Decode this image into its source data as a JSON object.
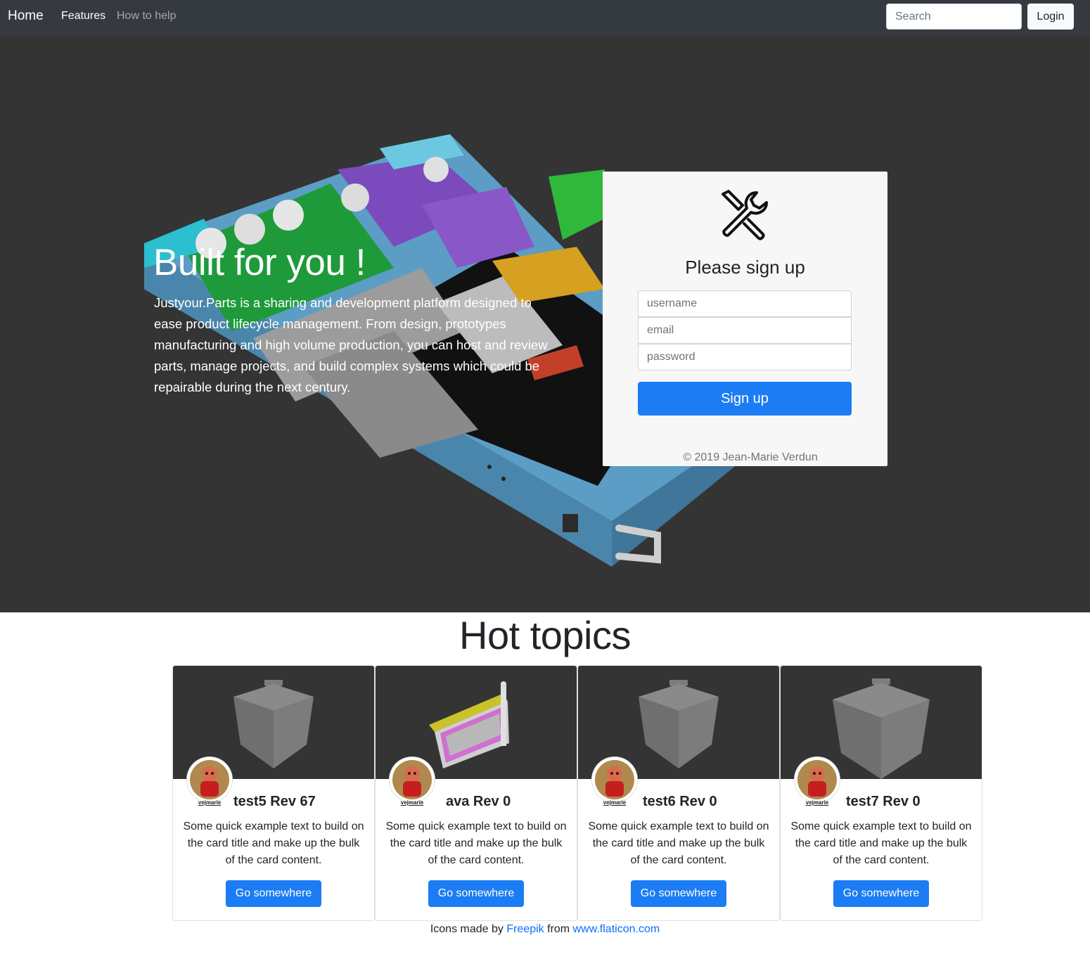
{
  "navbar": {
    "brand": "Home",
    "links": [
      "Features",
      "How to help"
    ],
    "search_placeholder": "Search",
    "login_label": "Login"
  },
  "hero": {
    "title": "Built for you !",
    "text": "Justyour.Parts is a sharing and development platform designed to ease product lifecycle management. From design, prototypes manufacturing and high volume production, you can host and review parts, manage projects, and build complex systems which could be repairable during the next century."
  },
  "signup": {
    "icon": "wrench-screwdriver-icon",
    "title": "Please sign up",
    "username_placeholder": "username",
    "email_placeholder": "email",
    "password_placeholder": "password",
    "button_label": "Sign up",
    "copyright": "© 2019 Jean-Marie Verdun"
  },
  "hot_topics": {
    "title": "Hot topics",
    "cards": [
      {
        "title": "test5 Rev 67",
        "author": "vejmarie",
        "text": "Some quick example text to build on the card title and make up the bulk of the card content.",
        "button_label": "Go somewhere",
        "image": "gray-box-icon"
      },
      {
        "title": "ava Rev 0",
        "author": "vejmarie",
        "text": "Some quick example text to build on the card title and make up the bulk of the card content.",
        "button_label": "Go somewhere",
        "image": "circuit-board-render"
      },
      {
        "title": "test6 Rev 0",
        "author": "vejmarie",
        "text": "Some quick example text to build on the card title and make up the bulk of the card content.",
        "button_label": "Go somewhere",
        "image": "gray-box-icon"
      },
      {
        "title": "test7 Rev 0",
        "author": "vejmarie",
        "text": "Some quick example text to build on the card title and make up the bulk of the card content.",
        "button_label": "Go somewhere",
        "image": "gray-box-icon"
      }
    ]
  },
  "footer": {
    "prefix": "Icons made by ",
    "author_link": "Freepik",
    "middle": " from ",
    "site_link": "www.flaticon.com"
  },
  "colors": {
    "navbar": "#343a40",
    "hero_bg": "#343434",
    "primary": "#1c7cf4",
    "link": "#0d6efd"
  }
}
